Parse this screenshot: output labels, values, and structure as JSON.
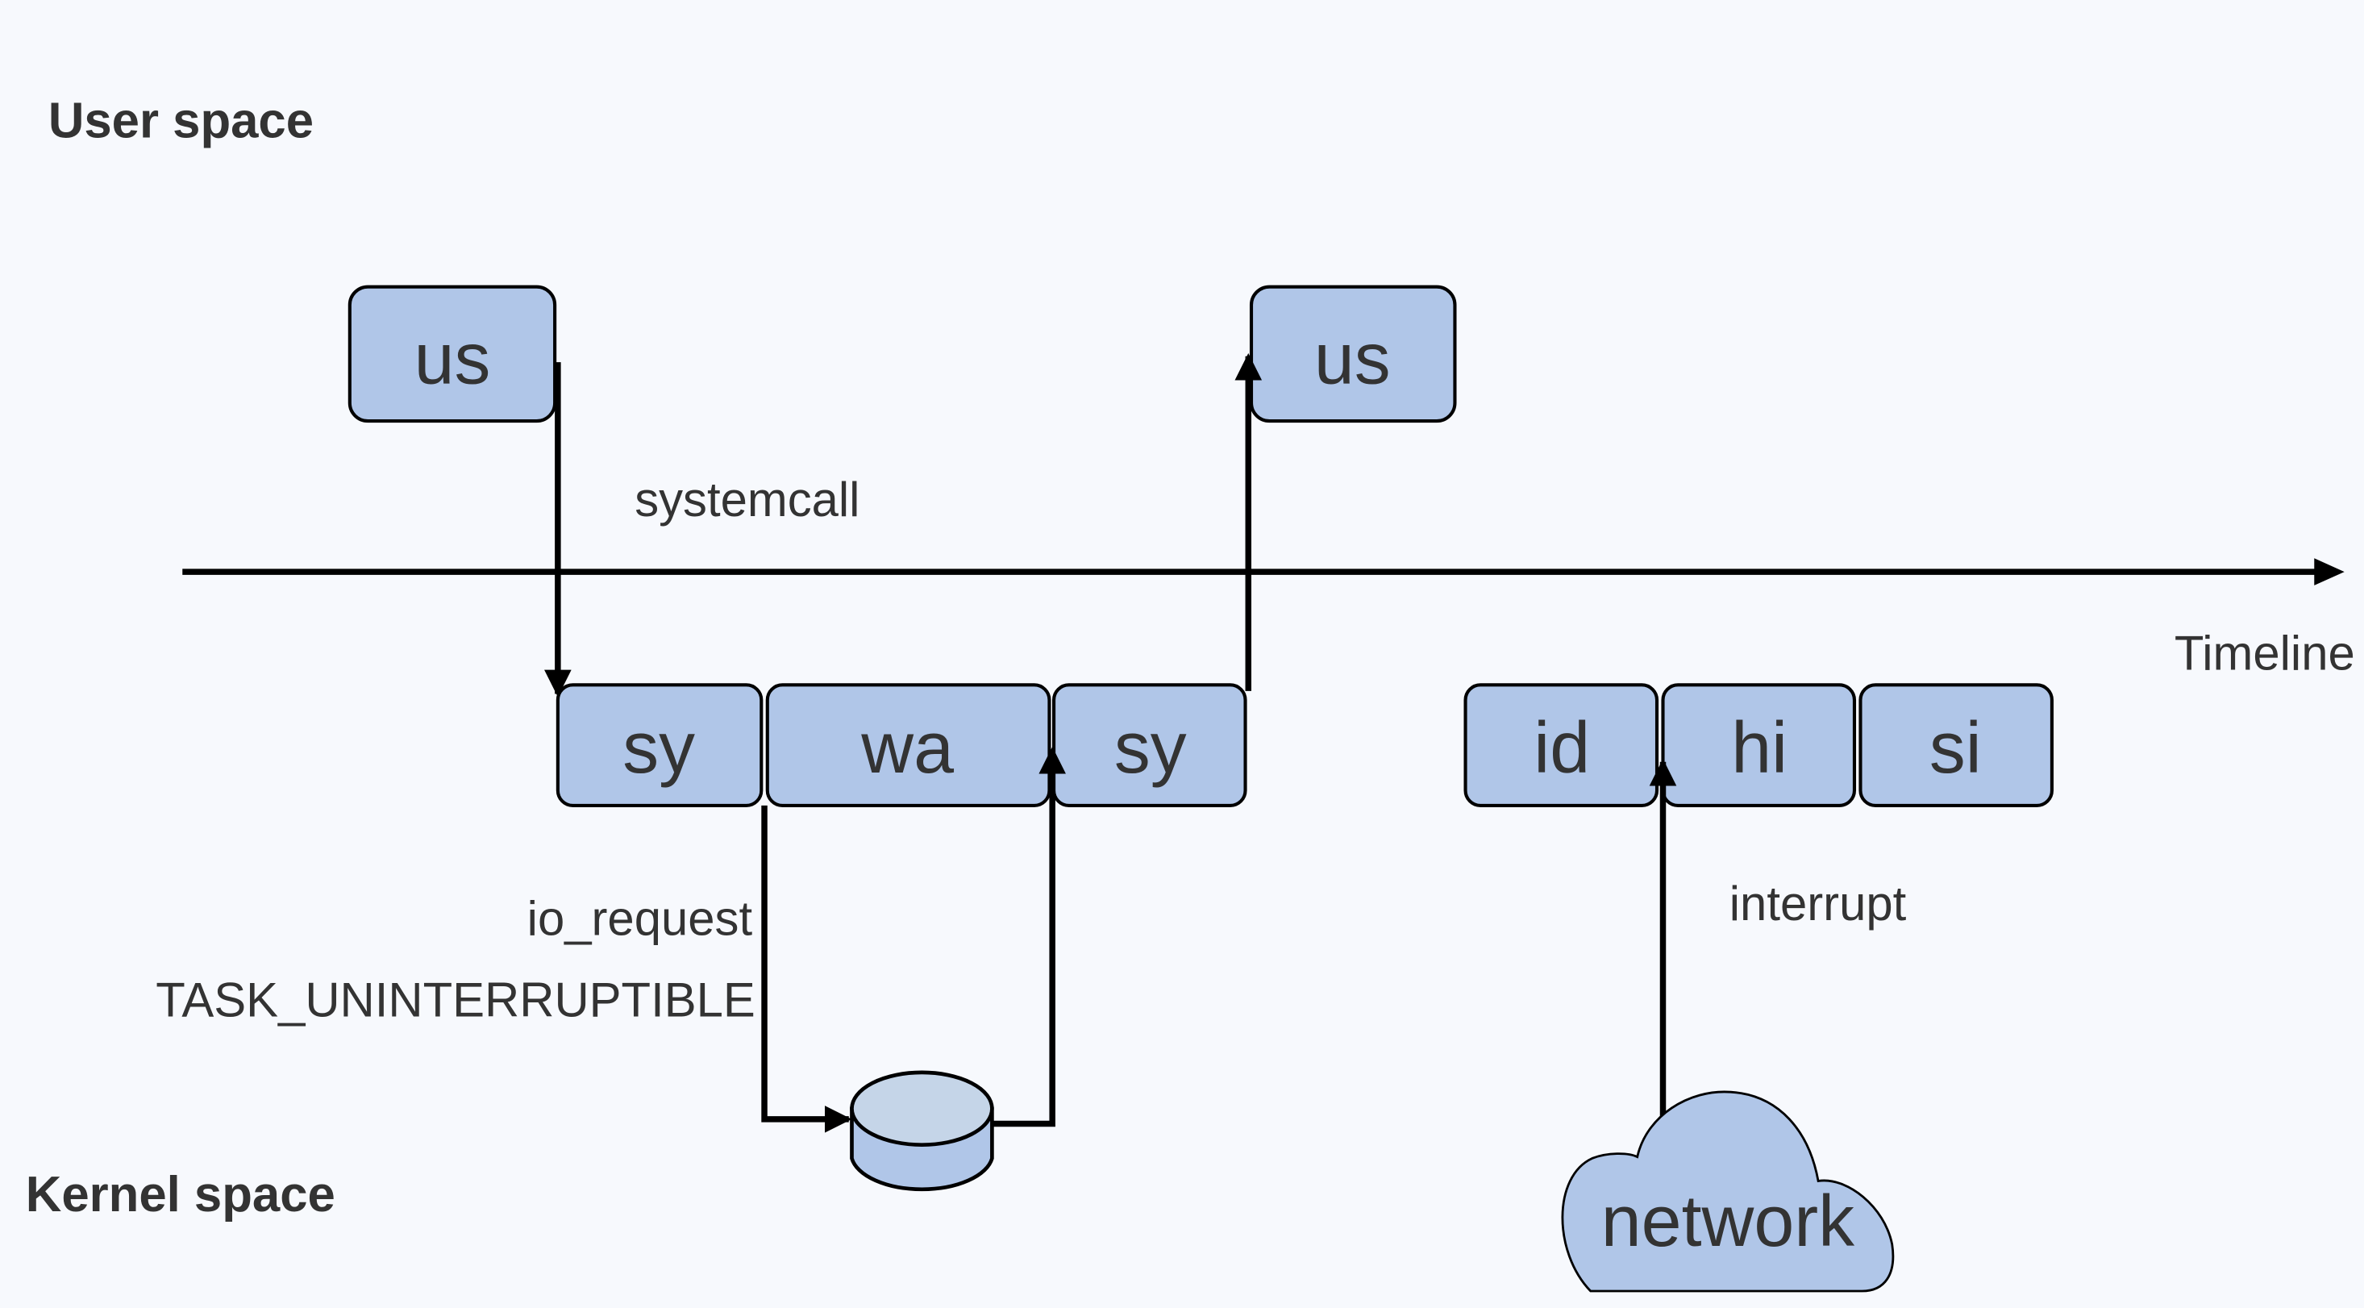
{
  "regions": {
    "user_space": "User space",
    "kernel_space": "Kernel space"
  },
  "timeline_label": "Timeline",
  "labels": {
    "systemcall": "systemcall",
    "io_request": "io_request",
    "task_state": "TASK_UNINTERRUPTIBLE",
    "interrupt": "interrupt"
  },
  "user_boxes": [
    "us",
    "us"
  ],
  "kernel_boxes": [
    "sy",
    "wa",
    "sy",
    "id",
    "hi",
    "si"
  ],
  "network": "network",
  "colors": {
    "box_fill": "#b0c6e8",
    "disk_top": "#c5d5e8",
    "background": "#f7f9fd",
    "line": "#000000"
  }
}
